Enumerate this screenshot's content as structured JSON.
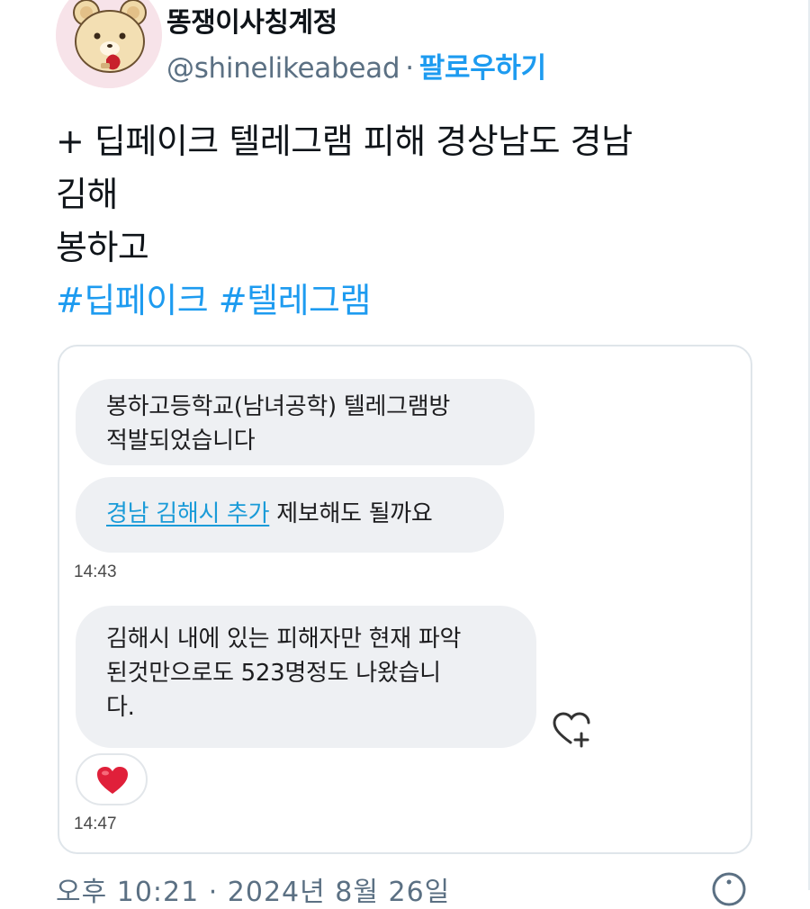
{
  "tweet": {
    "author": {
      "display_name": "똥쟁이사칭계정",
      "handle": "@shinelikeabead",
      "separator": "·",
      "follow_label": "팔로우하기",
      "avatar_icon": "bear-avatar-icon"
    },
    "text_lines": [
      "+ 딥페이크 텔레그램 피해 경상남도 경남",
      "김해",
      "봉하고"
    ],
    "hashtags": [
      "#딥페이크",
      "#텔레그램"
    ],
    "footer_meta": "오후 10:21 · 2024년 8월 26일",
    "info_icon": "info-icon"
  },
  "chat": {
    "messages": [
      {
        "line1": "봉하고등학교(남녀공학) 텔레그램방",
        "line2": "적발되었습니다"
      },
      {
        "link_text": "경남 김해시 추가",
        "rest_text": " 제보해도 될까요"
      },
      {
        "line1": "김해시 내에 있는 피해자만 현재 파악",
        "line2": "된것만으로도 523명정도 나왔습니",
        "line3": "다."
      }
    ],
    "timestamps": [
      "14:43",
      "14:47"
    ],
    "reaction_emoji": "heart-reaction-icon",
    "add_reaction_icon": "heart-plus-icon"
  },
  "colors": {
    "accent": "#1d9bf0",
    "secondary_text": "#5b7083",
    "bubble_bg": "#eef0f3",
    "heart": "#e0203a"
  }
}
